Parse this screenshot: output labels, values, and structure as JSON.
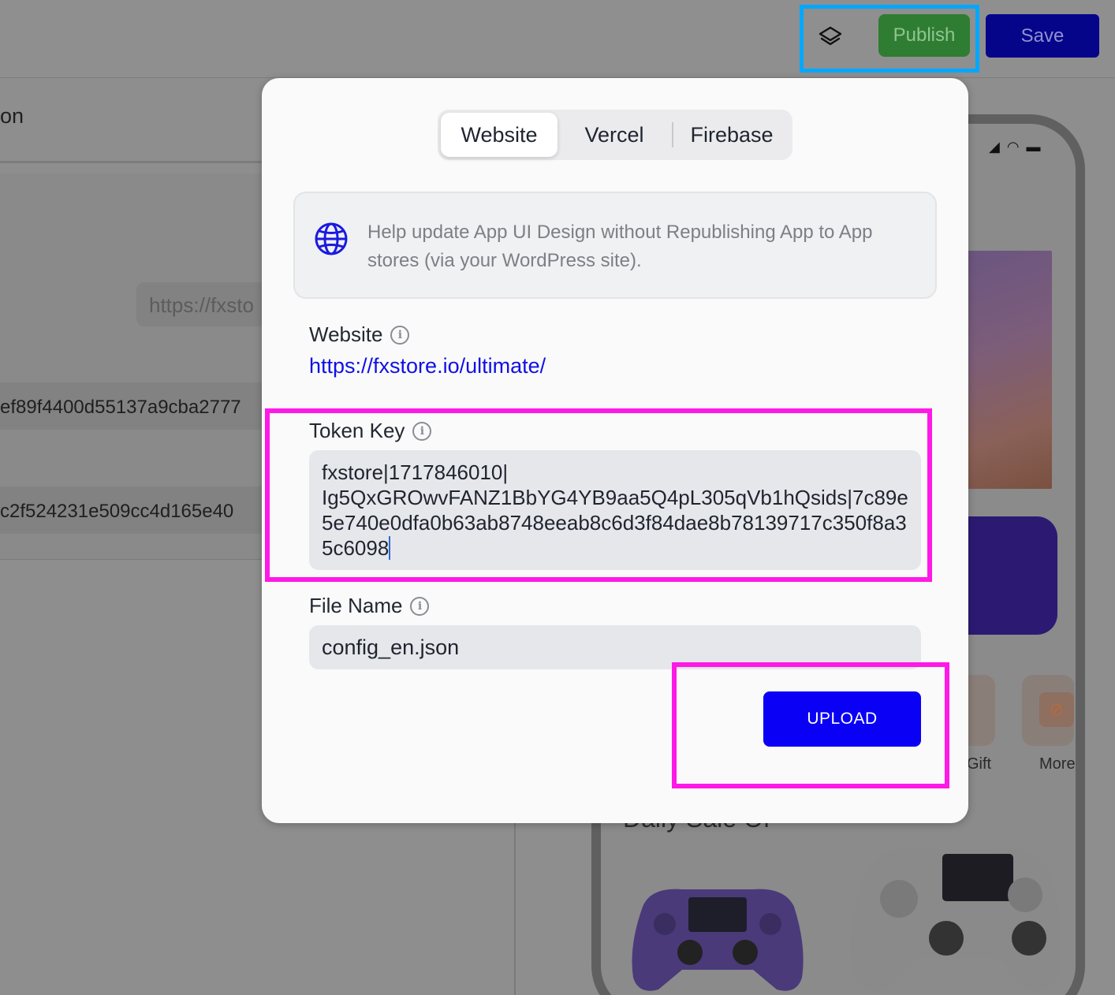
{
  "toolbar": {
    "layers_icon": "layers-icon",
    "publish_label": "Publish",
    "save_label": "Save"
  },
  "background": {
    "heading_fragment": "on",
    "url_fragment": "https://fxsto",
    "field_one_value": "ef89f4400d55137a9cba2777",
    "field_two_value": "c2f524231e509cc4d165e40",
    "phone": {
      "tile_gift_label": "Gift",
      "tile_more_label": "More",
      "section_title_fragment": "Daily Sale Of"
    }
  },
  "modal": {
    "tabs": [
      {
        "label": "Website",
        "active": true
      },
      {
        "label": "Vercel",
        "active": false
      },
      {
        "label": "Firebase",
        "active": false
      }
    ],
    "info_icon": "globe-icon",
    "info_text": "Help update App UI Design without Republishing App to App stores (via your WordPress site).",
    "website": {
      "label": "Website",
      "value": "https://fxstore.io/ultimate/"
    },
    "token_key": {
      "label": "Token Key",
      "value": "fxstore|1717846010|\nIg5QxGROwvFANZ1BbYG4YB9aa5Q4pL305qVb1hQsids|7c89e5e740e0dfa0b63ab8748eeab8c6d3f84dae8b78139717c350f8a35c6098"
    },
    "file_name": {
      "label": "File Name",
      "value": "config_en.json"
    },
    "upload_label": "UPLOAD"
  },
  "colors": {
    "accent_blue": "#0a00f5",
    "link_blue": "#1010e6",
    "publish_green": "#2f7d32",
    "highlight_magenta": "#ff19e6",
    "highlight_cyan": "#00a8ff"
  }
}
